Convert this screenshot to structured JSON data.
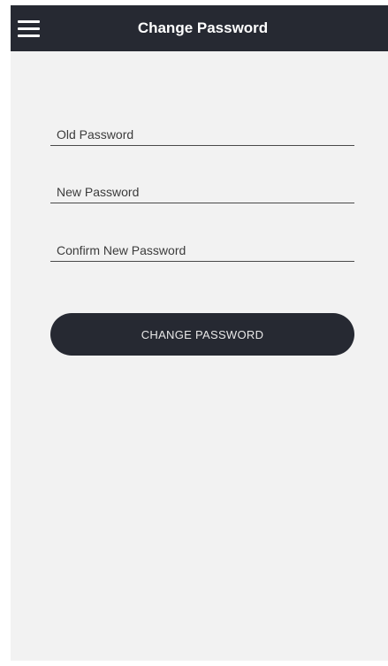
{
  "header": {
    "title": "Change Password",
    "menu_icon": "hamburger-menu-icon"
  },
  "form": {
    "old_password": {
      "placeholder": "Old Password",
      "value": ""
    },
    "new_password": {
      "placeholder": "New Password",
      "value": ""
    },
    "confirm_password": {
      "placeholder": "Confirm New Password",
      "value": ""
    },
    "submit_label": "CHANGE PASSWORD"
  },
  "colors": {
    "header_bg": "#262932",
    "button_bg": "#262932",
    "page_bg": "#f2f2f2",
    "underline": "#4a4a4a"
  }
}
